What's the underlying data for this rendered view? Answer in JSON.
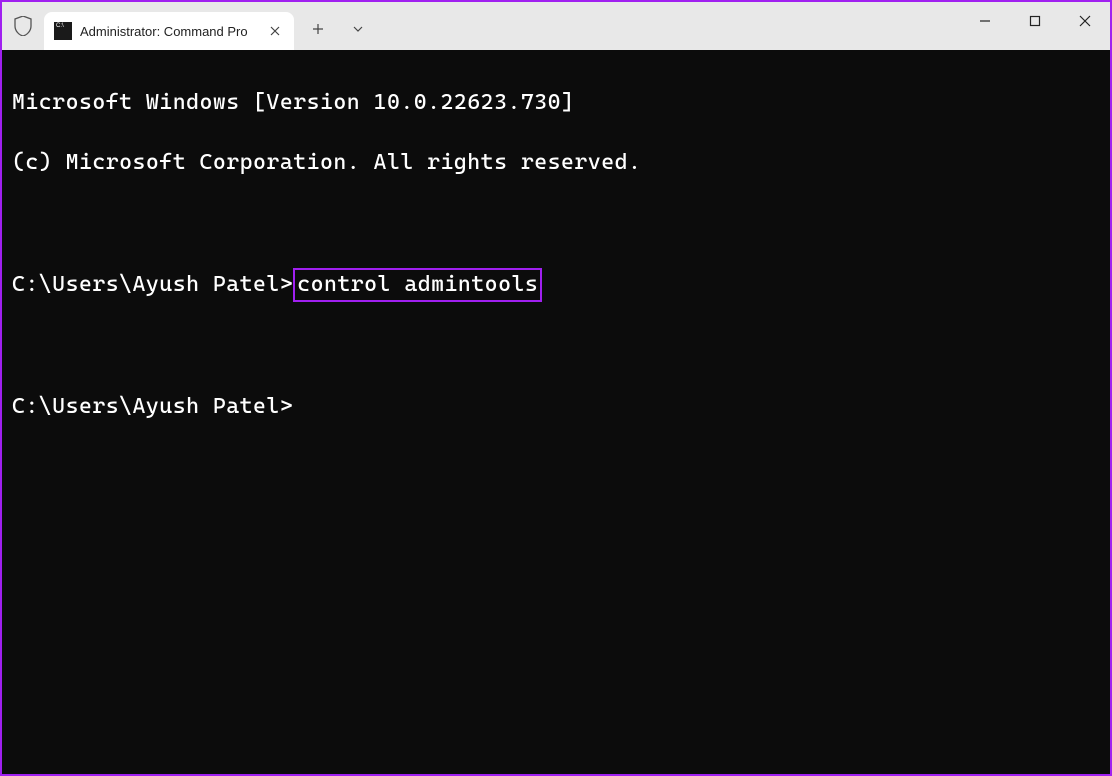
{
  "titlebar": {
    "tab_title": "Administrator: Command Pro",
    "tab_icon_text": "C:\\",
    "new_tab_label": "+",
    "dropdown_label": "v"
  },
  "window_controls": {
    "minimize": "—",
    "maximize": "▢",
    "close": "✕"
  },
  "terminal": {
    "line1": "Microsoft Windows [Version 10.0.22623.730]",
    "line2": "(c) Microsoft Corporation. All rights reserved.",
    "prompt1_prefix": "C:\\Users\\Ayush Patel>",
    "prompt1_command": "control admintools",
    "prompt2": "C:\\Users\\Ayush Patel>"
  }
}
